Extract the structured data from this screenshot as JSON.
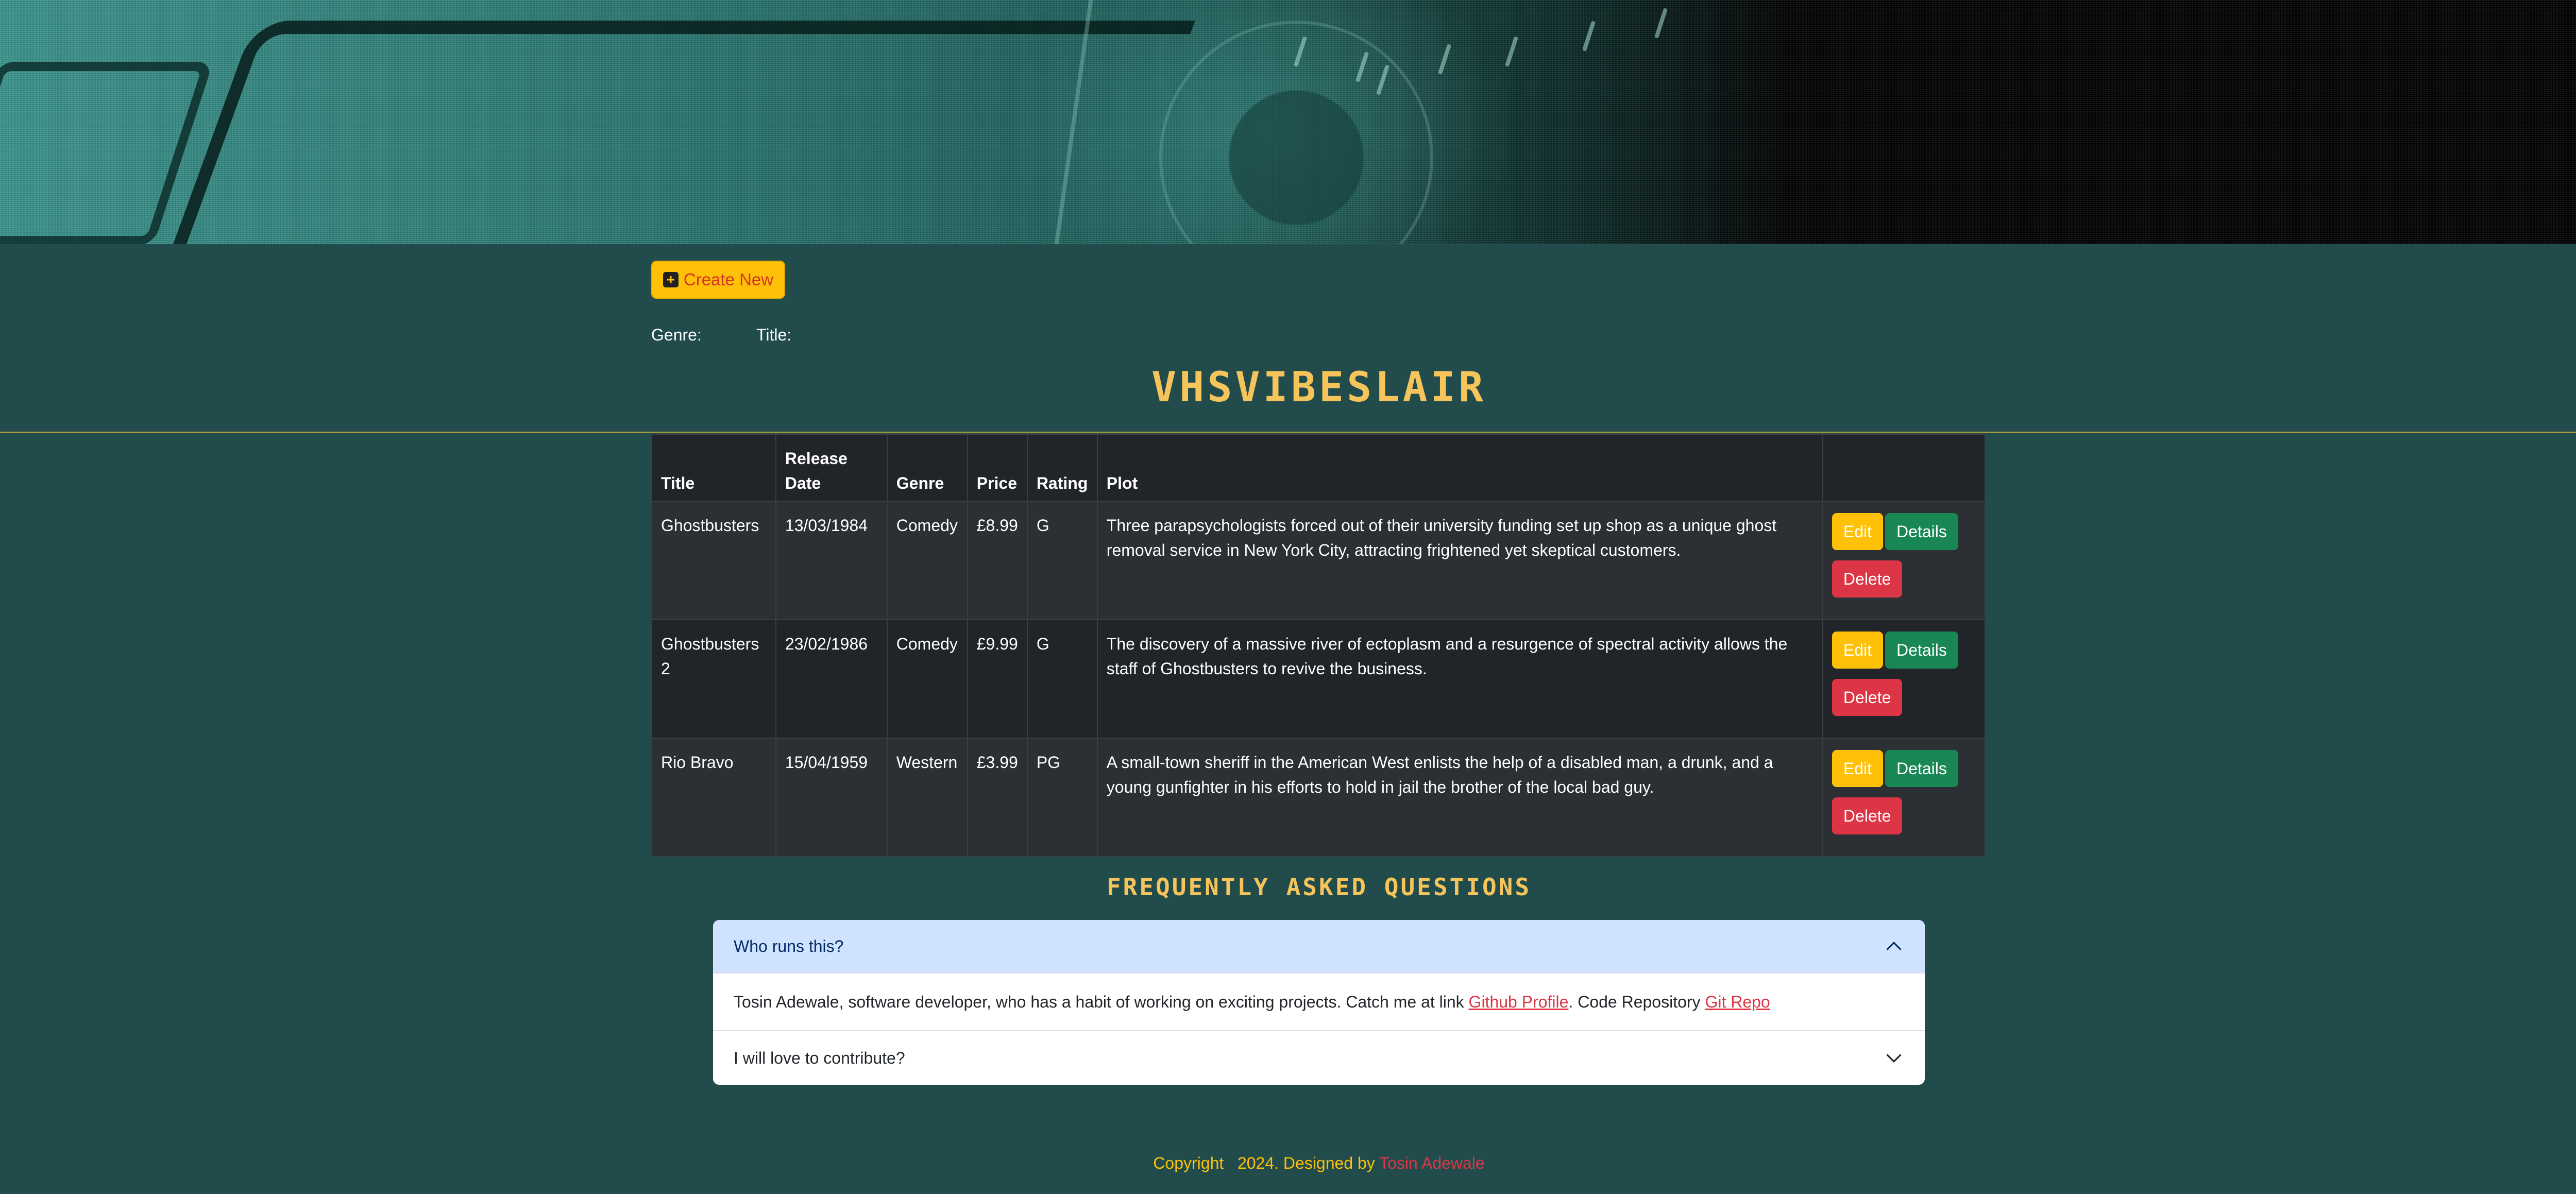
{
  "header": {
    "banner_alt": ""
  },
  "toolbar": {
    "create_label": "Create New",
    "create_icon": "plus-square-icon"
  },
  "filters": {
    "genre_label": "Genre:",
    "title_label": "Title:"
  },
  "brand": {
    "title": "VHSVIBESLAIR"
  },
  "table": {
    "headers": {
      "title": "Title",
      "release_date": "Release Date",
      "genre": "Genre",
      "price": "Price",
      "rating": "Rating",
      "plot": "Plot",
      "actions": ""
    },
    "rows": [
      {
        "title": "Ghostbusters",
        "release_date": "13/03/1984",
        "genre": "Comedy",
        "price": "£8.99",
        "rating": "G",
        "plot": "Three parapsychologists forced out of their university funding set up shop as a unique ghost removal service in New York City, attracting frightened yet skeptical customers.",
        "edit": "Edit",
        "details": "Details",
        "delete": "Delete"
      },
      {
        "title": "Ghostbusters 2",
        "release_date": "23/02/1986",
        "genre": "Comedy",
        "price": "£9.99",
        "rating": "G",
        "plot": "The discovery of a massive river of ectoplasm and a resurgence of spectral activity allows the staff of Ghostbusters to revive the business.",
        "edit": "Edit",
        "details": "Details",
        "delete": "Delete"
      },
      {
        "title": "Rio Bravo",
        "release_date": "15/04/1959",
        "genre": "Western",
        "price": "£3.99",
        "rating": "PG",
        "plot": "A small-town sheriff in the American West enlists the help of a disabled man, a drunk, and a young gunfighter in his efforts to hold in jail the brother of the local bad guy.",
        "edit": "Edit",
        "details": "Details",
        "delete": "Delete"
      }
    ]
  },
  "faq": {
    "title": "FREQUENTLY ASKED QUESTIONS",
    "items": [
      {
        "question": "Who runs this?",
        "expanded": true,
        "answer_prefix": "Tosin Adewale, software developer, who has a habit of working on exciting projects. Catch me at link ",
        "link1": "Github Profile",
        "answer_middle": ". Code Repository ",
        "link2": "Git Repo"
      },
      {
        "question": "I will love to contribute?",
        "expanded": false
      }
    ]
  },
  "footer": {
    "copyright": "Copyright   2024. Designed by ",
    "author": "Tosin Adewale"
  },
  "colors": {
    "background": "#224c4c",
    "brand": "#f5c45a",
    "edit": "#ffc107",
    "details": "#198754",
    "delete": "#dc3545",
    "link": "#dc3545"
  }
}
